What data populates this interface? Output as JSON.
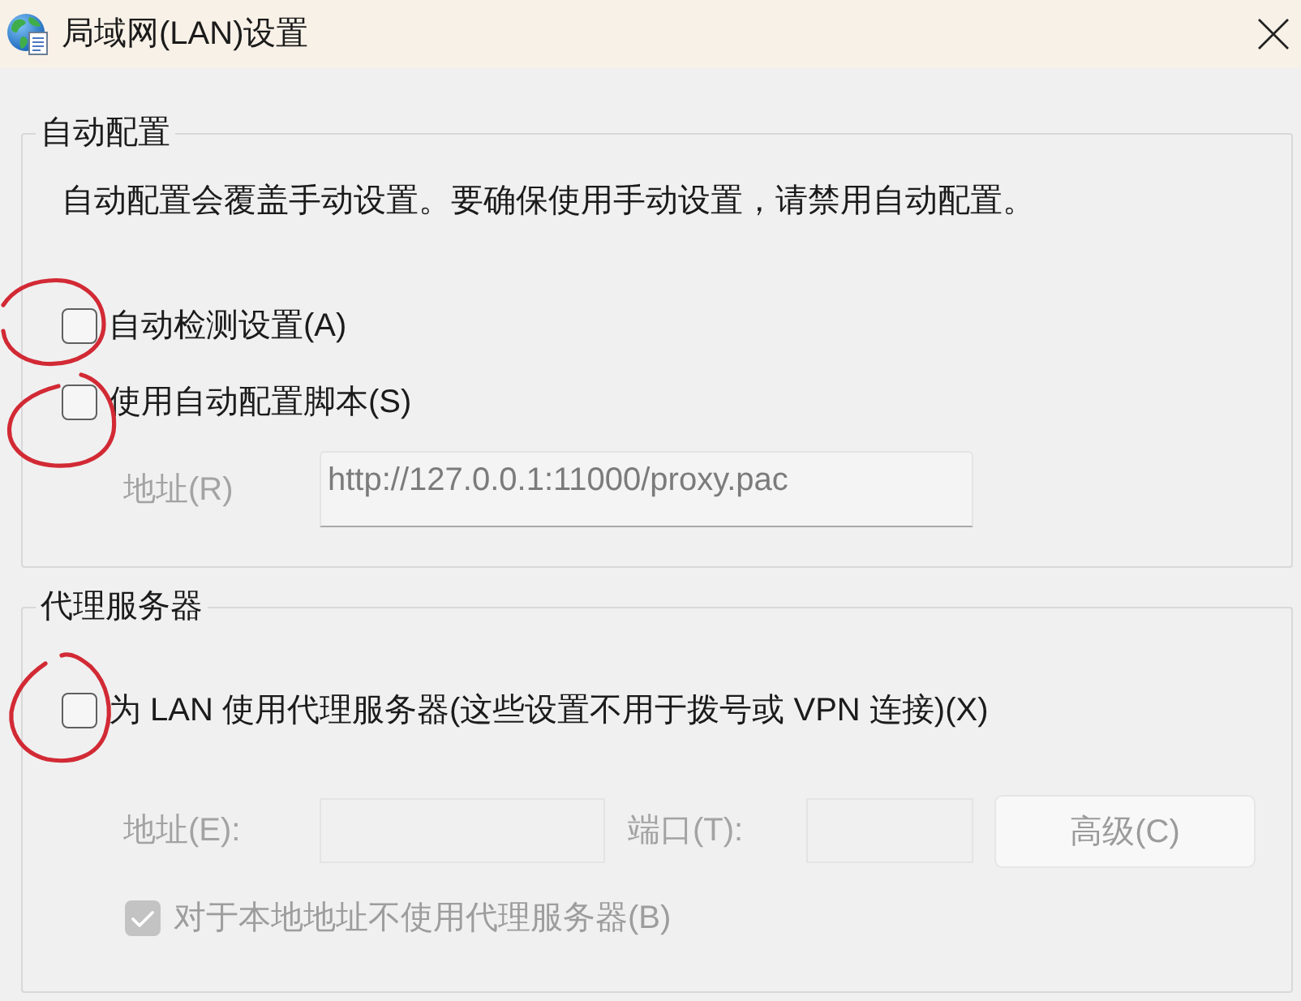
{
  "window": {
    "title": "局域网(LAN)设置"
  },
  "auto_config": {
    "title": "自动配置",
    "description": "自动配置会覆盖手动设置。要确保使用手动设置，请禁用自动配置。",
    "options": [
      {
        "label": "自动检测设置(A)",
        "checked": false,
        "disabled": false,
        "circled": true
      },
      {
        "label": "使用自动配置脚本(S)",
        "checked": false,
        "disabled": false,
        "circled": true
      }
    ],
    "address": {
      "label": "地址(R)",
      "value": "http://127.0.0.1:11000/proxy.pac",
      "disabled": true
    }
  },
  "proxy_server": {
    "title": "代理服务器",
    "use_proxy": {
      "label": "为 LAN 使用代理服务器(这些设置不用于拨号或 VPN 连接)(X)",
      "checked": false,
      "disabled": false,
      "circled": true
    },
    "address": {
      "label": "地址(E):",
      "disabled": true
    },
    "port": {
      "label": "端口(T):",
      "disabled": true
    },
    "advanced_button": {
      "label": "高级(C)",
      "disabled": true
    },
    "bypass_local": {
      "label": "对于本地地址不使用代理服务器(B)",
      "checked": true,
      "disabled": true
    }
  }
}
